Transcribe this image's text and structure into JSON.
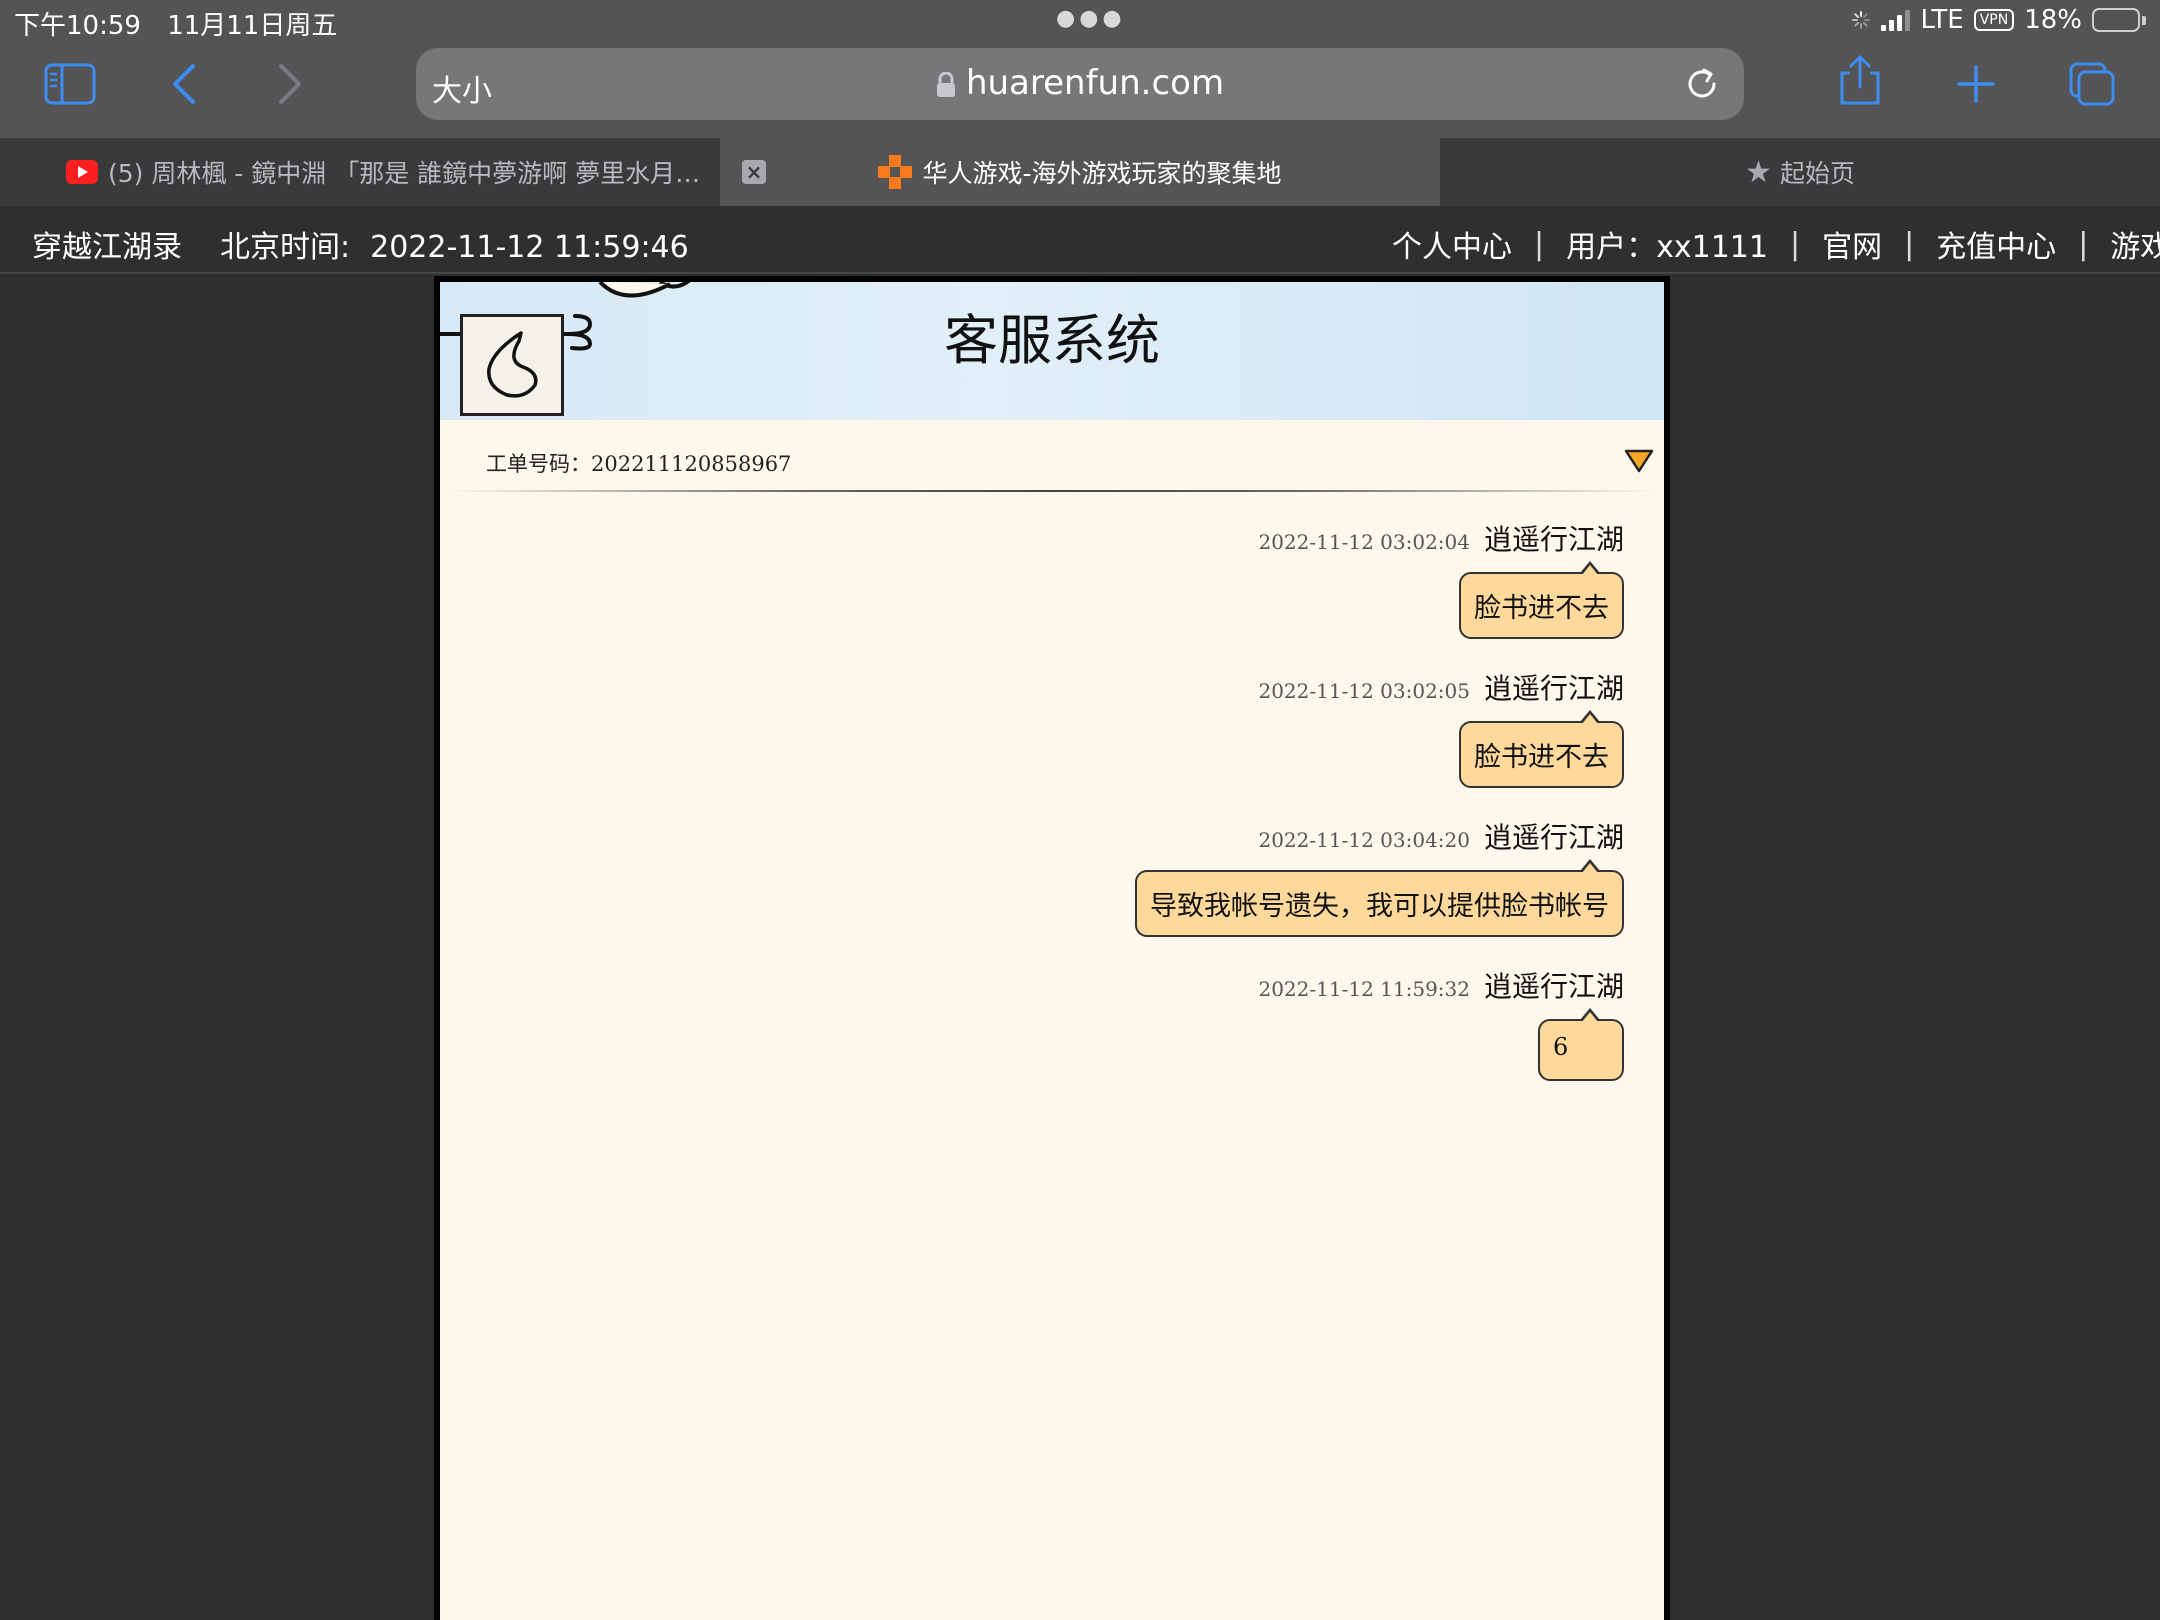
{
  "status_bar": {
    "time": "下午10:59",
    "date": "11月11日周五",
    "network": "LTE",
    "vpn": "VPN",
    "battery_percent": "18%",
    "battery_level": 0.18
  },
  "browser": {
    "text_size_button": "大小",
    "url": "huarenfun.com",
    "tabs": [
      {
        "label": "(5) 周林楓 - 鏡中淵 「那是 誰鏡中夢游啊 夢里水月…",
        "active": false
      },
      {
        "label": "华人游戏-海外游戏玩家的聚集地",
        "active": true
      },
      {
        "label": "起始页",
        "active": false
      }
    ]
  },
  "site_header": {
    "title": "穿越江湖录",
    "time_label": "北京时间:",
    "time_value": "2022-11-12 11:59:46",
    "nav": [
      {
        "label": "个人中心"
      },
      {
        "label": "用户：xx1111"
      },
      {
        "label": "官网"
      },
      {
        "label": "充值中心"
      },
      {
        "label": "游戏攻略"
      }
    ],
    "separator": "|"
  },
  "support": {
    "title": "客服系统",
    "ticket_label": "工单号码：202211120858967",
    "messages": [
      {
        "time": "2022-11-12 03:02:04",
        "user": "逍遥行江湖",
        "text": "脸书进不去"
      },
      {
        "time": "2022-11-12 03:02:05",
        "user": "逍遥行江湖",
        "text": "脸书进不去"
      },
      {
        "time": "2022-11-12 03:04:20",
        "user": "逍遥行江湖",
        "text": "导致我帐号遗失，我可以提供脸书帐号"
      },
      {
        "time": "2022-11-12 11:59:32",
        "user": "逍遥行江湖",
        "text": "6"
      }
    ]
  },
  "colors": {
    "accent_blue": "#3d8ef0",
    "bubble": "#fed99b",
    "frame_bg": "#fef8ec",
    "header_sky": "#d6e9f5",
    "dropdown": "#f5a623"
  }
}
